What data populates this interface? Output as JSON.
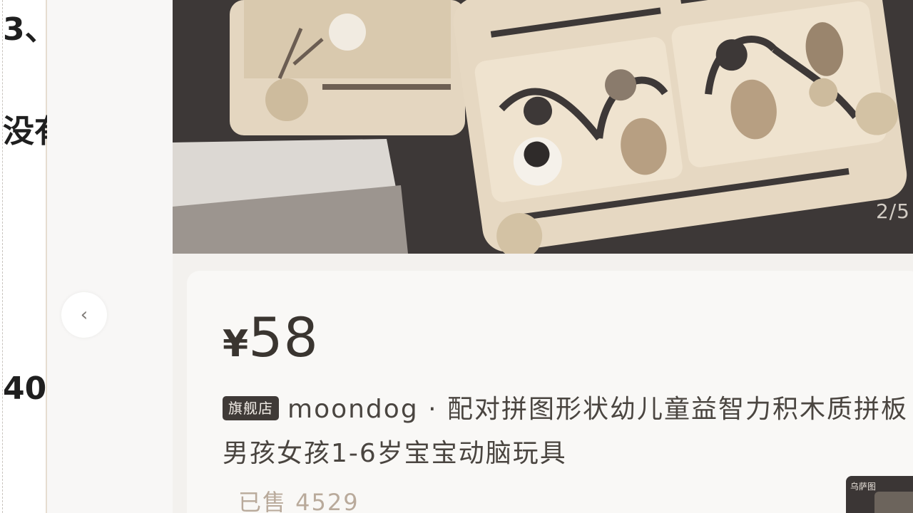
{
  "left_doc": {
    "fragment_1": "3、",
    "fragment_2": "没有",
    "fragment_3": "40"
  },
  "back_button": {
    "icon": "chevron-left-icon",
    "glyph": "‹"
  },
  "gallery": {
    "counter": "2/5"
  },
  "product": {
    "currency": "¥",
    "price": "58",
    "badge": "旗舰店",
    "title": "moondog · 配对拼图形状幼儿童益智力积木质拼板男孩女孩1-6岁宝宝动脑玩具",
    "sold": "已售 4529"
  },
  "thumbnail": {
    "label": "乌萨图"
  },
  "colors": {
    "image_bg": "#3d3837",
    "board": "#e5d7c1",
    "badge_bg": "#3f3a37",
    "sold_text": "#b9aa9b"
  }
}
